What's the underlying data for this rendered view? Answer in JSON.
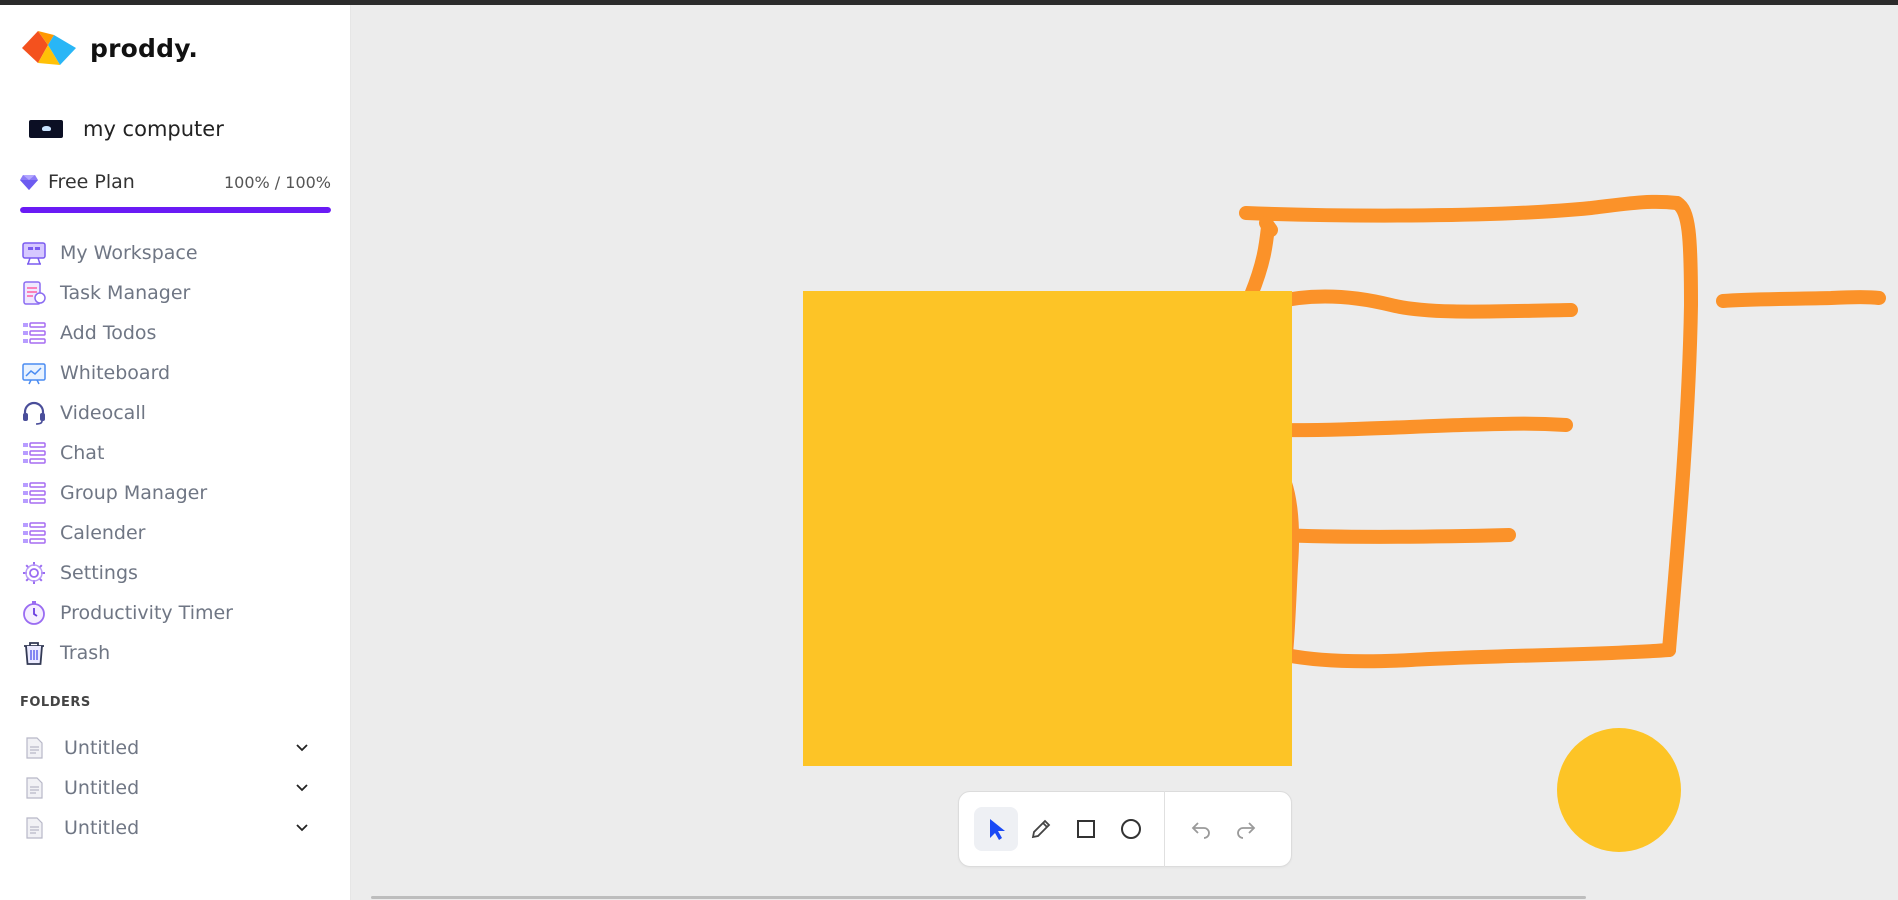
{
  "app": {
    "name": "proddy."
  },
  "workspace": {
    "name": "my computer"
  },
  "plan": {
    "label": "Free Plan",
    "usage_text": "100% / 100%",
    "usage_fraction": 1.0,
    "accent": "#6a1bf5"
  },
  "nav": {
    "items": [
      {
        "label": "My Workspace",
        "icon": "workspace-icon"
      },
      {
        "label": "Task Manager",
        "icon": "task-manager-icon"
      },
      {
        "label": "Add Todos",
        "icon": "list-icon"
      },
      {
        "label": "Whiteboard",
        "icon": "whiteboard-icon"
      },
      {
        "label": "Videocall",
        "icon": "headset-icon"
      },
      {
        "label": "Chat",
        "icon": "list-icon"
      },
      {
        "label": "Group Manager",
        "icon": "list-icon"
      },
      {
        "label": "Calender",
        "icon": "list-icon"
      },
      {
        "label": "Settings",
        "icon": "gear-icon"
      },
      {
        "label": "Productivity Timer",
        "icon": "timer-icon"
      },
      {
        "label": "Trash",
        "icon": "trash-icon"
      }
    ]
  },
  "folders": {
    "title": "FOLDERS",
    "items": [
      {
        "label": "Untitled"
      },
      {
        "label": "Untitled"
      },
      {
        "label": "Untitled"
      }
    ]
  },
  "whiteboard": {
    "fill_color": "#fdc426",
    "stroke_color": "#fb9229",
    "background": "#ececec"
  },
  "toolbar": {
    "tools": [
      "select-tool",
      "pen-tool",
      "rectangle-tool",
      "circle-tool"
    ],
    "active_tool": "select-tool",
    "history": [
      "undo",
      "redo"
    ],
    "active_color": "#1a49f5"
  }
}
